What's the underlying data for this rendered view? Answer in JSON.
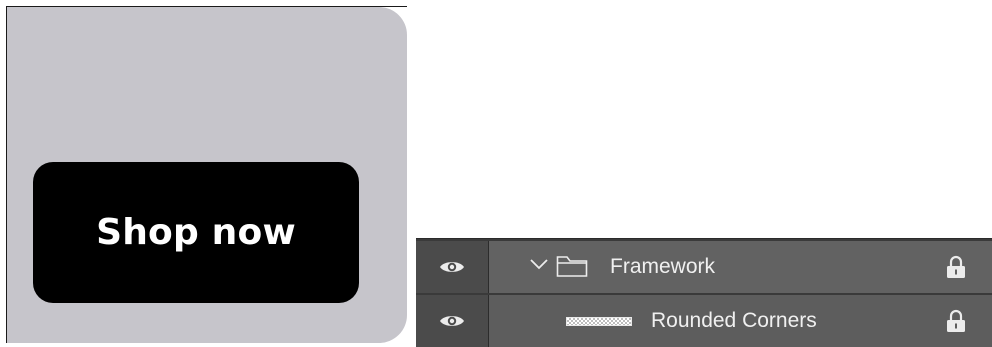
{
  "artboard": {
    "button_label": "Shop now",
    "colors": {
      "card_background": "#c6c5cb",
      "button_background": "#000000",
      "button_text": "#ffffff"
    }
  },
  "layers_panel": {
    "colors": {
      "panel_background": "#3a3a3a",
      "row_background": "#5d5d5d",
      "eye_column": "#4b4b4b",
      "text": "#f0f0f0"
    },
    "layers": [
      {
        "name": "Framework",
        "type": "group",
        "expanded": true,
        "visible": true,
        "locked": true,
        "icons": [
          "eye-icon",
          "chevron-down-icon",
          "folder-icon",
          "lock-icon"
        ]
      },
      {
        "name": "Rounded Corners",
        "type": "layer",
        "visible": true,
        "locked": true,
        "icons": [
          "eye-icon",
          "layer-thumbnail",
          "lock-icon"
        ]
      }
    ]
  }
}
